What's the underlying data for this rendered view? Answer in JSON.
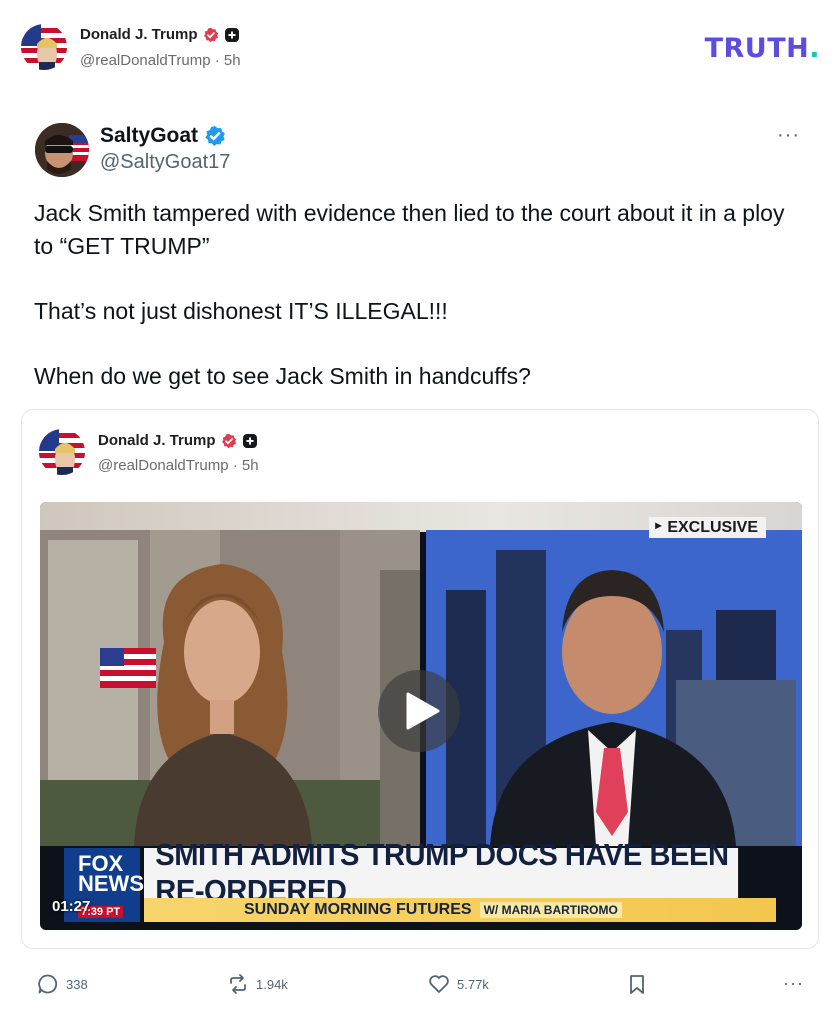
{
  "header": {
    "author_name": "Donald J. Trump",
    "author_handle": "@realDonaldTrump · 5h",
    "logo_text": "TRUTH",
    "logo_dot": "."
  },
  "post": {
    "author_name": "SaltyGoat",
    "author_handle": "@SaltyGoat17",
    "more_label": "···",
    "paragraphs": [
      "Jack Smith tampered with evidence then lied to the court about it in a ploy to “GET TRUMP”",
      "That’s not just dishonest IT’S ILLEGAL!!!",
      "When do we get to see Jack Smith in handcuffs?"
    ]
  },
  "quote": {
    "author_name": "Donald J. Trump",
    "author_handle": "@realDonaldTrump · 5h",
    "video": {
      "exclusive_label": "EXCLUSIVE",
      "headline": "SMITH ADMITS TRUMP DOCS HAVE BEEN RE-ORDERED",
      "show": "SUNDAY MORNING FUTURES",
      "host": "W/ MARIA BARTIROMO",
      "network_line1": "FOX",
      "network_line2": "NEWS",
      "clock": "7:39 PT",
      "time": "01:27"
    }
  },
  "actions": {
    "replies": "338",
    "retruths": "1.94k",
    "likes": "5.77k",
    "more": "···"
  },
  "colors": {
    "brand": "#5b4de0",
    "verified_blue": "#1d9bf0",
    "trump_badge": "#e63950",
    "text_secondary": "#536471"
  }
}
